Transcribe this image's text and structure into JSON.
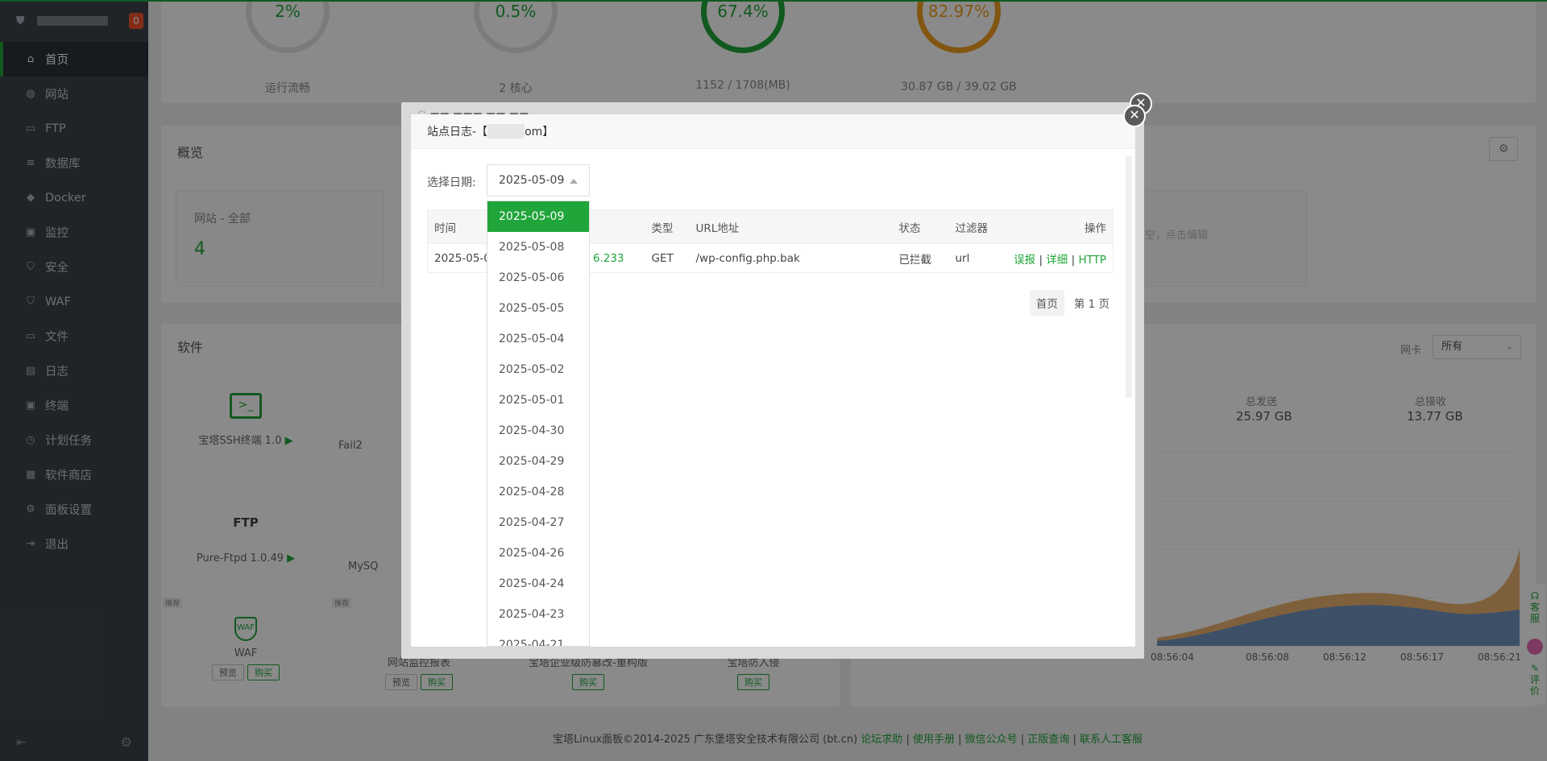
{
  "sidebar": {
    "badge": "0",
    "items": [
      {
        "label": "首页",
        "icon": "home-icon",
        "glyph": "⌂"
      },
      {
        "label": "网站",
        "icon": "globe-icon",
        "glyph": "◍"
      },
      {
        "label": "FTP",
        "icon": "folder-icon",
        "glyph": "▭"
      },
      {
        "label": "数据库",
        "icon": "database-icon",
        "glyph": "≡"
      },
      {
        "label": "Docker",
        "icon": "docker-icon",
        "glyph": "◆"
      },
      {
        "label": "监控",
        "icon": "monitor-icon",
        "glyph": "▣"
      },
      {
        "label": "安全",
        "icon": "shield-icon",
        "glyph": "⛉"
      },
      {
        "label": "WAF",
        "icon": "waf-icon",
        "glyph": "⛉"
      },
      {
        "label": "文件",
        "icon": "file-icon",
        "glyph": "▭"
      },
      {
        "label": "日志",
        "icon": "log-icon",
        "glyph": "▤"
      },
      {
        "label": "终端",
        "icon": "terminal-icon",
        "glyph": "▣"
      },
      {
        "label": "计划任务",
        "icon": "clock-icon",
        "glyph": "◷"
      },
      {
        "label": "软件商店",
        "icon": "grid-icon",
        "glyph": "▦"
      },
      {
        "label": "面板设置",
        "icon": "gear-icon",
        "glyph": "⚙"
      },
      {
        "label": "退出",
        "icon": "logout-icon",
        "glyph": "⇥"
      }
    ]
  },
  "gauges": [
    {
      "value": "2%",
      "label": "运行流畅"
    },
    {
      "value": "0.5%",
      "label": "2 核心"
    },
    {
      "value": "67.4%",
      "label": "1152 / 1708(MB)"
    },
    {
      "value": "82.97%",
      "label": "30.87 GB / 39.02 GB"
    }
  ],
  "overview": {
    "title": "概览",
    "site_label": "网站 - 全部",
    "site_count": "4",
    "hint": "空，点击编辑"
  },
  "software": {
    "title": "软件",
    "ssh": "宝塔SSH终端 1.0",
    "fail2": "Fail2",
    "ftp_logo": "FTP",
    "ftp": "Pure-Ftpd 1.0.49",
    "mysql": "MySQ",
    "waf": "WAF",
    "tag": "推荐",
    "preview": "预览",
    "buy": "购买",
    "site_monitor": "网站监控报表",
    "enterprise": "宝塔企业级防篡改-重构版",
    "intrusion": "宝塔防入侵"
  },
  "traffic": {
    "nic_label": "网卡",
    "nic_value": "所有",
    "sent_label": "总发送",
    "sent_value": "25.97 GB",
    "recv_label": "总接收",
    "recv_value": "13.77 GB",
    "times": [
      "08:56:04",
      "08:56:08",
      "08:56:12",
      "08:56:17",
      "08:56:21"
    ]
  },
  "dialog": {
    "title_prefix": "站点日志-【",
    "title_suffix": "om】",
    "date_label": "选择日期:",
    "selected_date": "2025-05-09",
    "columns": [
      "时间",
      "类型",
      "URL地址",
      "状态",
      "过滤器",
      "操作"
    ],
    "row": {
      "time": "2025-05-0",
      "ip": "6.233",
      "type": "GET",
      "url": "/wp-config.php.bak",
      "status": "已拦截",
      "filter": "url",
      "op1": "误报",
      "op2": "详细",
      "op3": "HTTP"
    },
    "pager_first": "首页",
    "pager_page": "第 1 页"
  },
  "dropdown": [
    "2025-05-09",
    "2025-05-08",
    "2025-05-06",
    "2025-05-05",
    "2025-05-04",
    "2025-05-02",
    "2025-05-01",
    "2025-04-30",
    "2025-04-29",
    "2025-04-28",
    "2025-04-27",
    "2025-04-26",
    "2025-04-24",
    "2025-04-23",
    "2025-04-21"
  ],
  "footer": {
    "copyright": "宝塔Linux面板©2014-2025 广东堡塔安全技术有限公司 (bt.cn)",
    "links": [
      "论坛求助",
      "使用手册",
      "微信公众号",
      "正版查询",
      "联系人工客服"
    ]
  },
  "float_tab": "客服",
  "float_tab2": "评价",
  "colors": {
    "accent": "#20a53a",
    "warn": "#f0a020",
    "sidebar": "#3c444d"
  }
}
